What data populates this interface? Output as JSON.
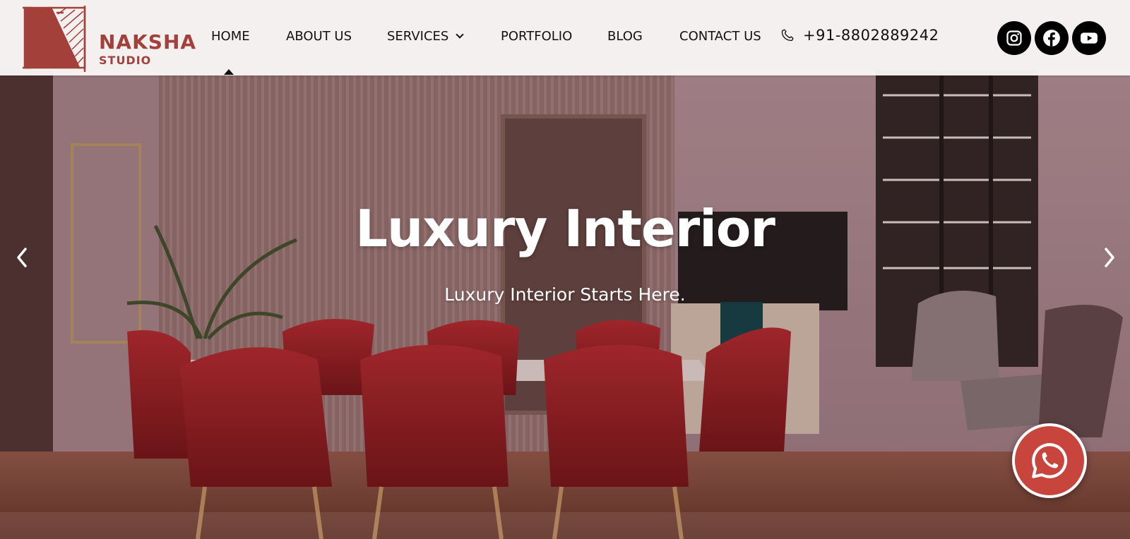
{
  "brand": {
    "name": "NAKSHA",
    "sub": "STUDIO"
  },
  "nav": {
    "items": [
      {
        "label": "HOME",
        "active": true
      },
      {
        "label": "ABOUT US"
      },
      {
        "label": "SERVICES"
      },
      {
        "label": "PORTFOLIO"
      },
      {
        "label": "BLOG"
      },
      {
        "label": "CONTACT US"
      }
    ],
    "phone": "+91-8802889242"
  },
  "social": {
    "icons": [
      "instagram-icon",
      "facebook-icon",
      "youtube-icon"
    ]
  },
  "hero": {
    "title": "Luxury Interior",
    "subtitle": "Luxury Interior Starts Here."
  },
  "colors": {
    "brand": "#a3403a",
    "whatsapp": "#c8453d",
    "header_bg": "#faf6f6"
  }
}
